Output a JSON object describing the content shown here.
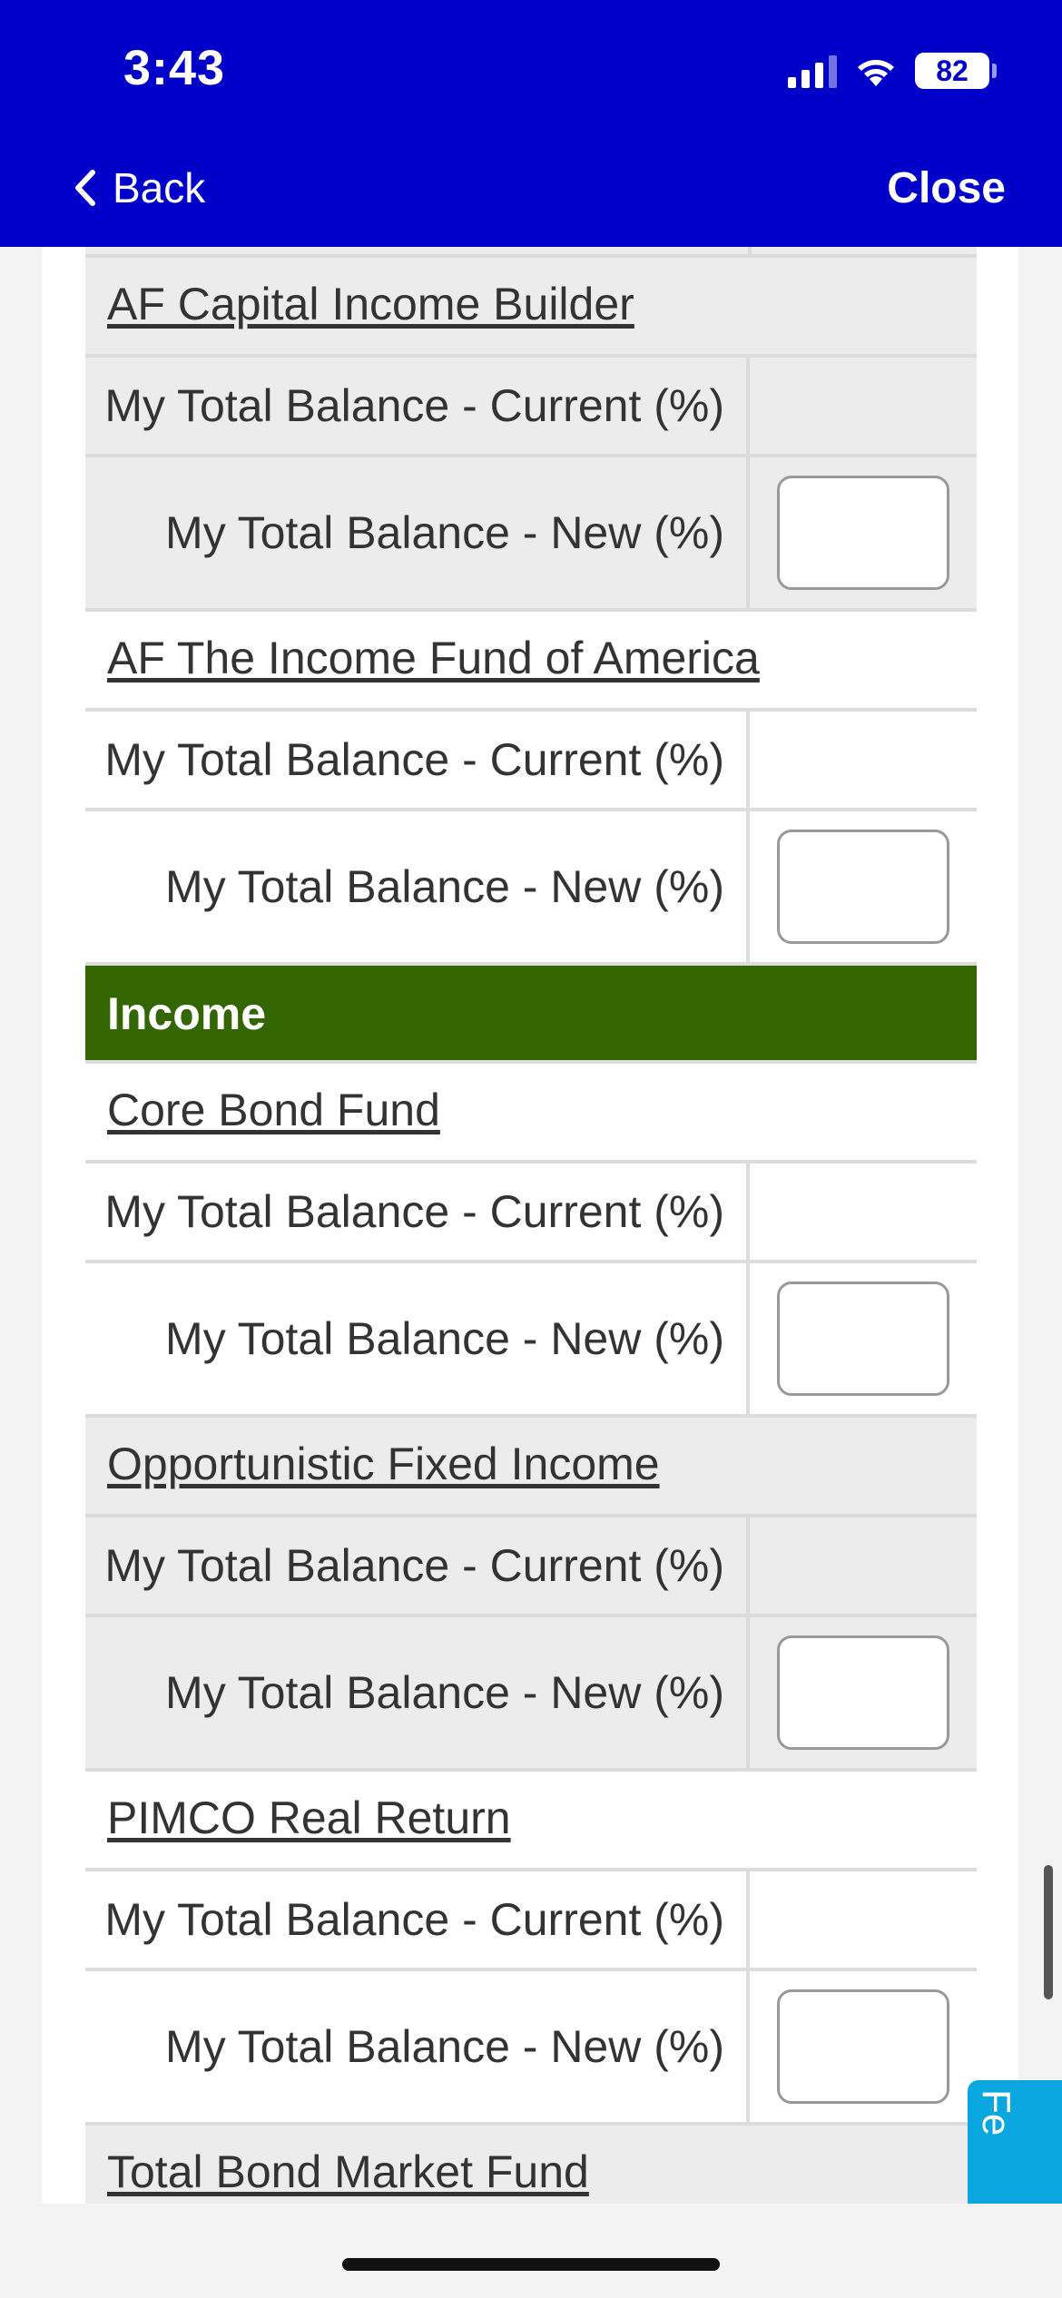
{
  "status_bar": {
    "time": "3:43",
    "battery": "82"
  },
  "nav": {
    "back_label": "Back",
    "close_label": "Close"
  },
  "rows": {
    "current_label": "My Total Balance - Current (%)",
    "new_label": "My Total Balance - New (%)"
  },
  "funds_before": [
    {
      "name": "AF Capital Income Builder",
      "current_value": "",
      "new_value": ""
    },
    {
      "name": "AF The Income Fund of America",
      "current_value": "",
      "new_value": ""
    }
  ],
  "category": {
    "name": "Income",
    "color": "#336600"
  },
  "funds_after": [
    {
      "name": "Core Bond Fund",
      "current_value": "",
      "new_value": ""
    },
    {
      "name": "Opportunistic Fixed Income",
      "current_value": "",
      "new_value": ""
    },
    {
      "name": "PIMCO Real Return",
      "current_value": "",
      "new_value": ""
    },
    {
      "name": "Total Bond Market Fund"
    }
  ],
  "feedback_tab_label": "Fe",
  "colors": {
    "header_blue": "#0000c8",
    "category_green": "#336600",
    "feedback_blue": "#0aa6e0"
  }
}
